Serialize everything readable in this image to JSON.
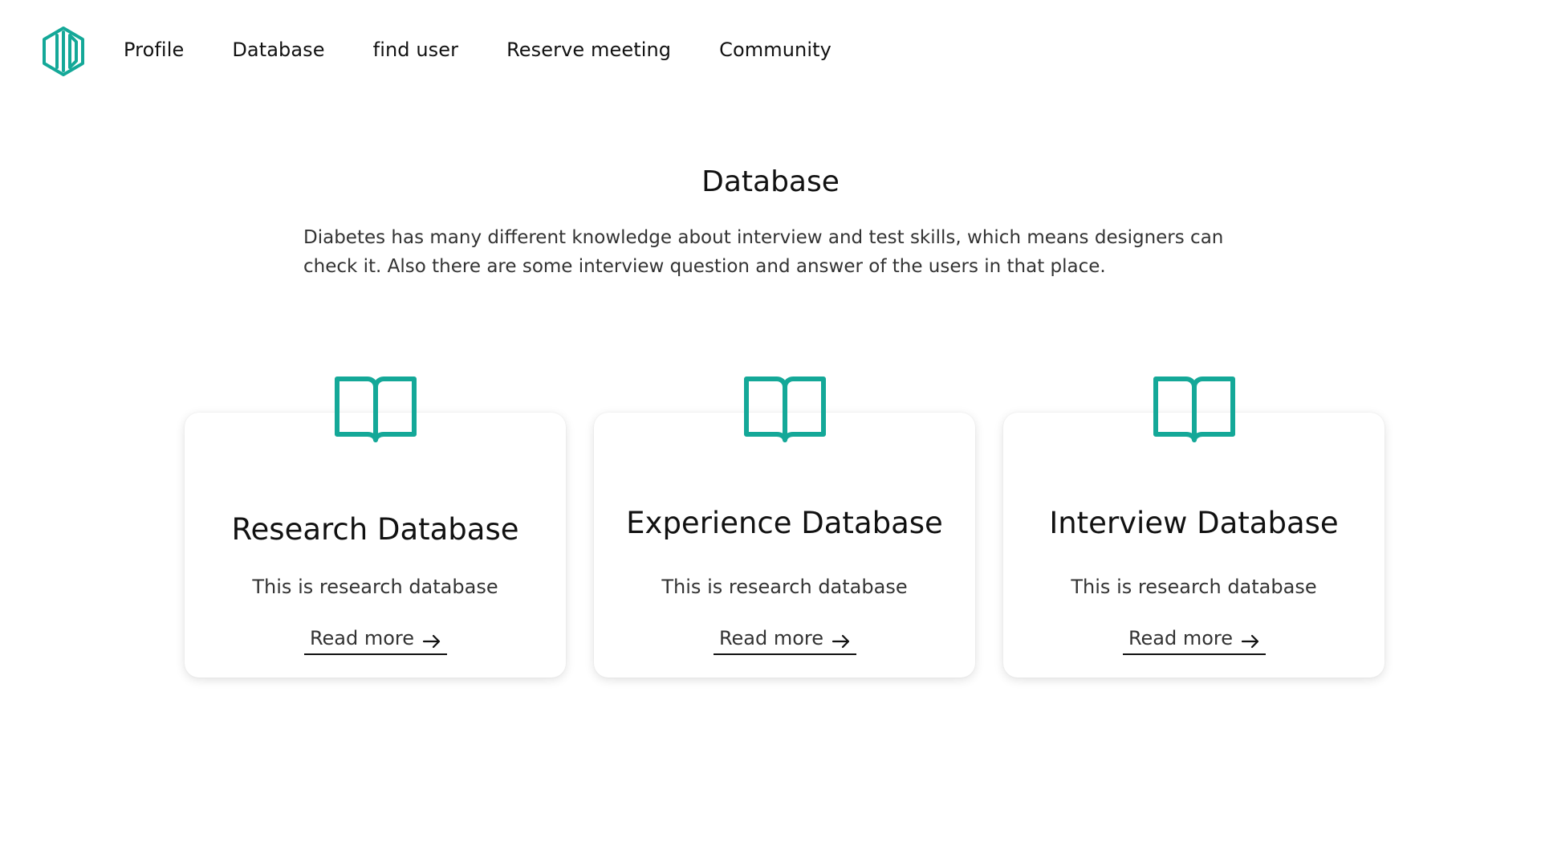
{
  "brand": {
    "logo_icon": "hexagon-logo-icon",
    "accent_color": "#14a898"
  },
  "nav": {
    "items": [
      {
        "label": "Profile"
      },
      {
        "label": "Database"
      },
      {
        "label": "find user"
      },
      {
        "label": "Reserve meeting"
      },
      {
        "label": "Community"
      }
    ]
  },
  "main": {
    "title": "Database",
    "description": "Diabetes has many different knowledge about interview and test skills, which means designers can check it. Also there are some interview question and answer of the users in that place."
  },
  "cards": [
    {
      "icon": "open-book-icon",
      "title": "Research Database",
      "text": "This is research database",
      "link_label": "Read more",
      "link_icon": "arrow-right-icon"
    },
    {
      "icon": "open-book-icon",
      "title": "Experience Database",
      "text": "This is research database",
      "link_label": "Read more",
      "link_icon": "arrow-right-icon"
    },
    {
      "icon": "open-book-icon",
      "title": "Interview Database",
      "text": "This is research database",
      "link_label": "Read more",
      "link_icon": "arrow-right-icon"
    }
  ]
}
